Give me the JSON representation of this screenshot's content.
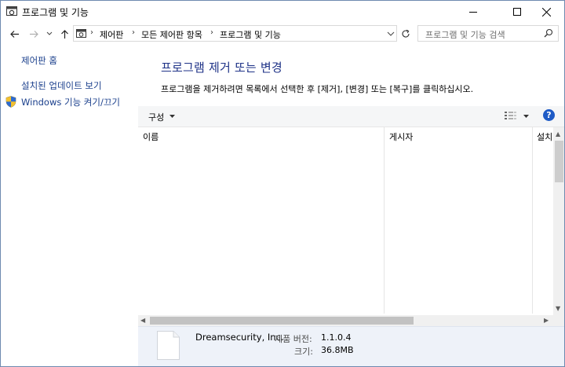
{
  "window": {
    "title": "프로그램 및 기능"
  },
  "address_bar": {
    "breadcrumbs": [
      "제어판",
      "모든 제어판 항목",
      "프로그램 및 기능"
    ]
  },
  "search": {
    "placeholder": "프로그램 및 기능 검색"
  },
  "sidebar": {
    "items": [
      {
        "label": "제어판 홈"
      },
      {
        "label": "설치된 업데이트 보기"
      },
      {
        "label": "Windows 기능 켜기/끄기",
        "icon": "shield-icon"
      }
    ]
  },
  "main": {
    "heading": "프로그램 제거 또는 변경",
    "instructions": "프로그램을 제거하려면 목록에서 선택한 후 [제거], [변경] 또는 [복구]를 클릭하십시오."
  },
  "toolbar": {
    "organize_label": "구성",
    "help_label": "?"
  },
  "list": {
    "columns": [
      "이름",
      "게시자",
      "설치"
    ],
    "rows": []
  },
  "details": {
    "publisher": "Dreamsecurity, Inc.",
    "version_label": "제품 버전:",
    "version_value": "1.1.0.4",
    "size_label": "크기:",
    "size_value": "36.8MB"
  },
  "colors": {
    "link": "#1a3f8c",
    "heading": "#1e3287",
    "details_bg": "#eef2f9",
    "help_button": "#1e5bc6"
  }
}
